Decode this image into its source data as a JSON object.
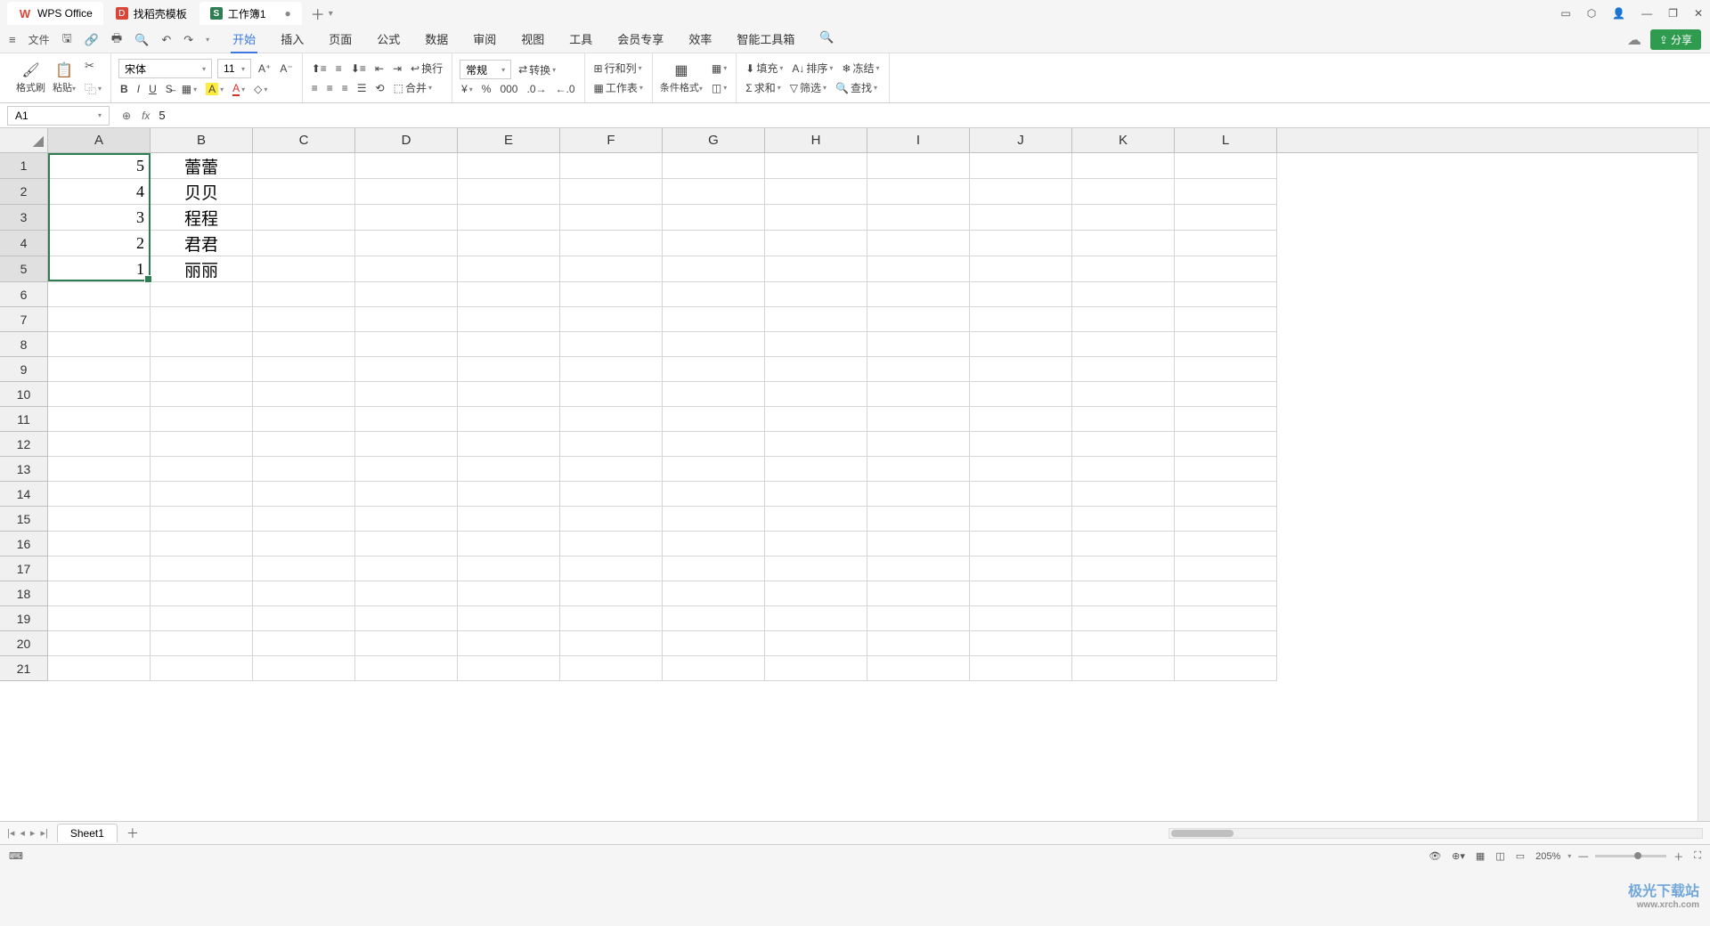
{
  "tabs": {
    "app": "WPS Office",
    "template": "找稻壳模板",
    "workbook": "工作簿1"
  },
  "menu": {
    "file": "文件",
    "items": [
      "开始",
      "插入",
      "页面",
      "公式",
      "数据",
      "审阅",
      "视图",
      "工具",
      "会员专享",
      "效率",
      "智能工具箱"
    ],
    "share": "分享"
  },
  "ribbon": {
    "format_painter": "格式刷",
    "paste": "粘贴",
    "font_name": "宋体",
    "font_size": "11",
    "wrap": "换行",
    "merge": "合并",
    "number_format": "常规",
    "convert": "转换",
    "rowcol": "行和列",
    "worksheet": "工作表",
    "cond_format": "条件格式",
    "fill": "填充",
    "sort": "排序",
    "freeze": "冻结",
    "sum": "求和",
    "filter": "筛选",
    "find": "查找"
  },
  "namebox": "A1",
  "formula_value": "5",
  "columns": [
    "A",
    "B",
    "C",
    "D",
    "E",
    "F",
    "G",
    "H",
    "I",
    "J",
    "K",
    "L"
  ],
  "rows_visible": 21,
  "sheet_data": {
    "A": [
      "5",
      "4",
      "3",
      "2",
      "1"
    ],
    "B": [
      "蕾蕾",
      "贝贝",
      "程程",
      "君君",
      "丽丽"
    ]
  },
  "selection": {
    "ref": "A1:A5",
    "active": "A1"
  },
  "sheet_tab": "Sheet1",
  "status": {
    "zoom": "205%"
  },
  "watermark": {
    "l1": "极光下载站",
    "l2": "www.xrch.com"
  }
}
